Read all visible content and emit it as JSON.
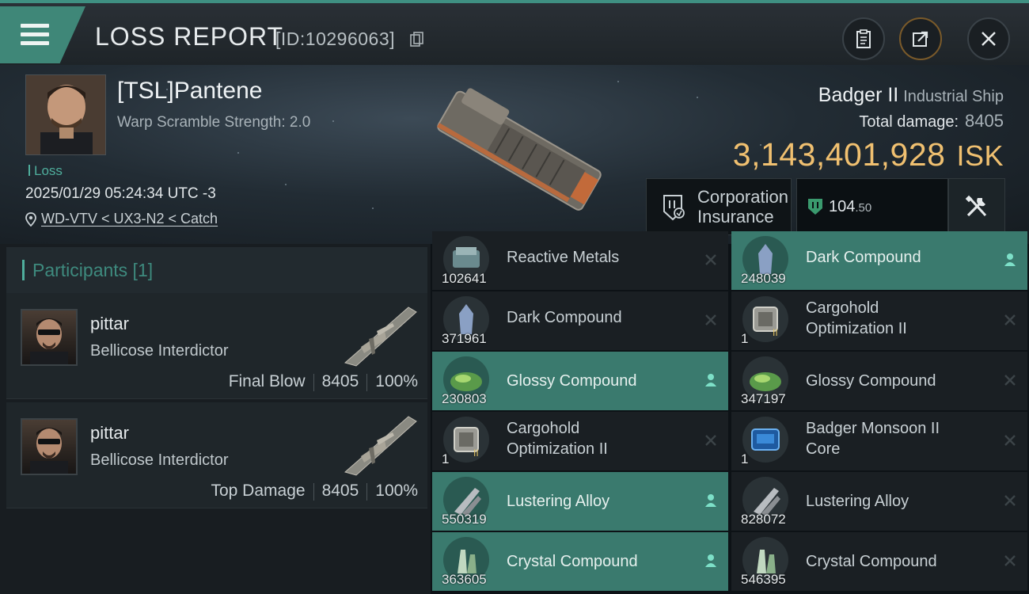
{
  "header": {
    "title": "LOSS REPORT",
    "report_id": "[ID:10296063]"
  },
  "victim": {
    "name": "[TSL]Pantene",
    "warp_scramble": "Warp Scramble Strength: 2.0",
    "loss_label": "Loss",
    "timestamp": "2025/01/29 05:24:34 UTC -3",
    "location": "WD-VTV < UX3-N2 < Catch",
    "ship_name": "Badger II",
    "ship_class": "Industrial Ship",
    "total_damage_label": "Total damage:",
    "total_damage": "8405",
    "isk_value": "3,143,401,928",
    "isk_unit": "ISK",
    "insurance_label_1": "Corporation",
    "insurance_label_2": "Insurance",
    "insurance_whole": "104",
    "insurance_decimal": ".50"
  },
  "participants": {
    "title": "Participants [1]",
    "list": [
      {
        "name": "pittar",
        "ship": "Bellicose Interdictor",
        "tag": "Final Blow",
        "damage": "8405",
        "percent": "100%"
      },
      {
        "name": "pittar",
        "ship": "Bellicose Interdictor",
        "tag": "Top Damage",
        "damage": "8405",
        "percent": "100%"
      }
    ]
  },
  "items": [
    {
      "name": "Reactive Metals",
      "qty": "102641",
      "state": "destroyed",
      "icon": "reactive-metals-icon"
    },
    {
      "name": "Dark Compound",
      "qty": "248039",
      "state": "dropped",
      "icon": "dark-compound-icon"
    },
    {
      "name": "Dark Compound",
      "qty": "371961",
      "state": "destroyed",
      "icon": "dark-compound-icon"
    },
    {
      "name": "Cargohold Optimization II",
      "name_l1": "Cargohold",
      "name_l2": "Optimization II",
      "qty": "1",
      "state": "destroyed",
      "icon": "cargohold-rig-icon"
    },
    {
      "name": "Glossy Compound",
      "qty": "230803",
      "state": "dropped",
      "icon": "glossy-compound-icon"
    },
    {
      "name": "Glossy Compound",
      "qty": "347197",
      "state": "destroyed",
      "icon": "glossy-compound-icon"
    },
    {
      "name": "Cargohold Optimization II",
      "name_l1": "Cargohold",
      "name_l2": "Optimization II",
      "qty": "1",
      "state": "destroyed",
      "icon": "cargohold-rig-icon"
    },
    {
      "name": "Badger Monsoon II Core",
      "name_l1": "Badger Monsoon II",
      "name_l2": "Core",
      "qty": "1",
      "state": "destroyed",
      "icon": "ship-core-icon"
    },
    {
      "name": "Lustering Alloy",
      "qty": "550319",
      "state": "dropped",
      "icon": "lustering-alloy-icon"
    },
    {
      "name": "Lustering Alloy",
      "qty": "828072",
      "state": "destroyed",
      "icon": "lustering-alloy-icon"
    },
    {
      "name": "Crystal Compound",
      "qty": "363605",
      "state": "dropped",
      "icon": "crystal-compound-icon"
    },
    {
      "name": "Crystal Compound",
      "qty": "546395",
      "state": "destroyed",
      "icon": "crystal-compound-icon"
    }
  ],
  "colors": {
    "accent": "#3f8778",
    "isk": "#f0c070",
    "dropped_row": "#3a7a6e"
  }
}
